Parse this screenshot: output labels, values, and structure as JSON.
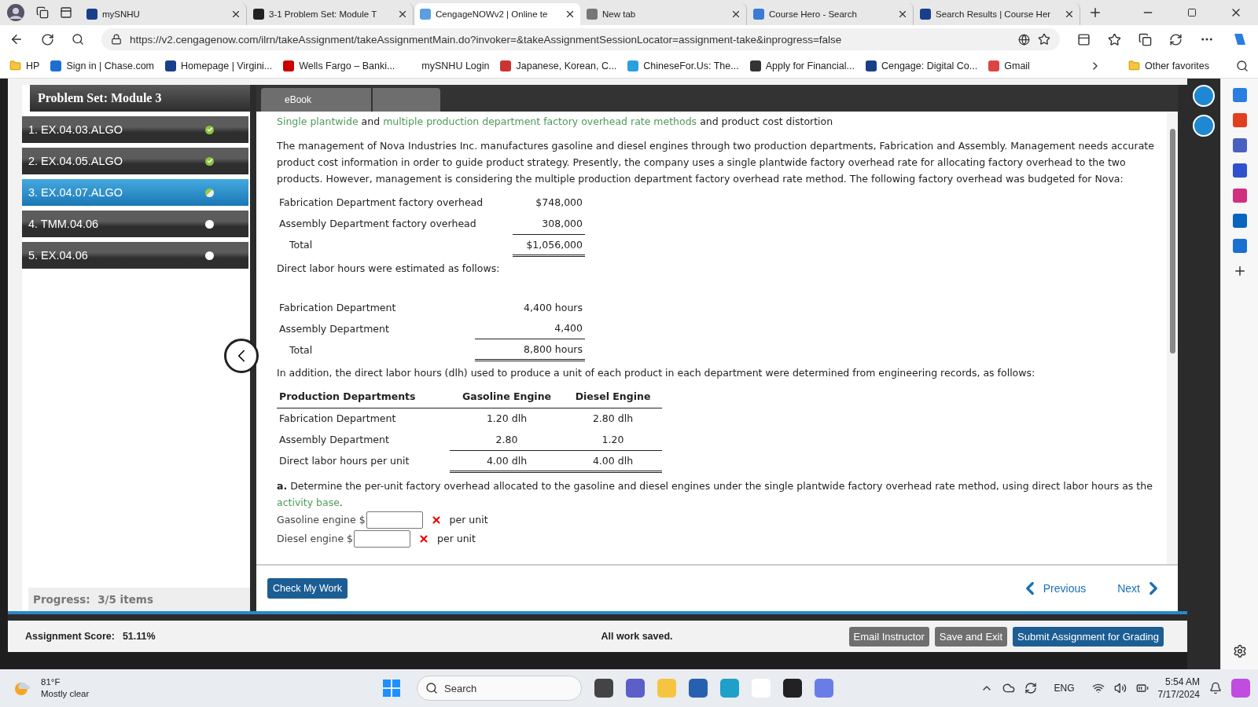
{
  "browser": {
    "tabs": [
      {
        "title": "mySNHU",
        "selected": false
      },
      {
        "title": "3-1 Problem Set: Module T",
        "selected": false
      },
      {
        "title": "CengageNOWv2 | Online te",
        "selected": true
      },
      {
        "title": "New tab",
        "selected": false
      },
      {
        "title": "Course Hero - Search",
        "selected": false
      },
      {
        "title": "Search Results | Course Her",
        "selected": false
      }
    ],
    "url": "https://v2.cengagenow.com/ilrn/takeAssignment/takeAssignmentMain.do?invoker=&takeAssignmentSessionLocator=assignment-take&inprogress=false",
    "bookmarks": [
      "HP",
      "Sign in | Chase.com",
      "Homepage | Virgini...",
      "Wells Fargo – Banki...",
      "mySNHU Login",
      "Japanese, Korean, C...",
      "ChineseFor.Us: The...",
      "Apply for Financial...",
      "Cengage: Digital Co...",
      "Gmail"
    ],
    "other_favorites": "Other favorites"
  },
  "assignment": {
    "title": "Problem Set: Module 3",
    "ebook_tab": "eBook",
    "items": [
      {
        "label": "1. EX.04.03.ALGO",
        "selected": false,
        "kind": "complete"
      },
      {
        "label": "2. EX.04.05.ALGO",
        "selected": false,
        "kind": "complete"
      },
      {
        "label": "3. EX.04.07.ALGO",
        "selected": true,
        "kind": "partial"
      },
      {
        "label": "4. TMM.04.06",
        "selected": false,
        "kind": "open"
      },
      {
        "label": "5. EX.04.06",
        "selected": false,
        "kind": "open"
      }
    ],
    "progress": "Progress:  3/5 items"
  },
  "content": {
    "heading": [
      {
        "kind": "link",
        "text": "Single plantwide"
      },
      {
        "kind": "text",
        "text": "and"
      },
      {
        "kind": "link",
        "text": "multiple production department factory overhead rate methods"
      },
      {
        "kind": "text",
        "text": "and product cost distortion"
      }
    ],
    "intro": "The management of Nova Industries Inc. manufactures gasoline and diesel engines through two production departments, Fabrication and Assembly. Management needs accurate product cost information in order to guide product strategy. Presently, the company uses a single plantwide factory overhead rate for allocating factory overhead to the two products. However, management is considering the multiple production department factory overhead rate method. The following factory overhead was budgeted for Nova:",
    "overhead": [
      {
        "label": "Fabrication Department factory overhead",
        "amount": "$748,000",
        "kind": "item"
      },
      {
        "label": "Assembly Department factory overhead",
        "amount": "308,000",
        "kind": "item"
      },
      {
        "label": "Total",
        "amount": "$1,056,000",
        "kind": "total"
      }
    ],
    "hours_intro": "Direct labor hours were estimated as follows:",
    "hours": [
      {
        "label": "Fabrication Department",
        "amount": "4,400 hours",
        "kind": "item"
      },
      {
        "label": "Assembly Department",
        "amount": "4,400",
        "kind": "item"
      },
      {
        "label": "Total",
        "amount": "8,800 hours",
        "kind": "total"
      }
    ],
    "dlh_intro": "In addition, the direct labor hours (dlh) used to produce a unit of each product in each department were determined from engineering records, as follows:",
    "production": {
      "columns": [
        "Production Departments",
        "Gasoline Engine",
        "Diesel Engine"
      ],
      "rows": [
        {
          "cells": [
            "Fabrication Department",
            "1.20 dlh",
            "2.80 dlh"
          ],
          "kind": "item"
        },
        {
          "cells": [
            "Assembly Department",
            "2.80",
            "1.20"
          ],
          "kind": "item"
        },
        {
          "cells": [
            "Direct labor hours per unit",
            "4.00 dlh",
            "4.00 dlh"
          ],
          "kind": "total"
        }
      ]
    },
    "question": {
      "letter": "a.",
      "text": "Determine the per-unit factory overhead allocated to the gasoline and diesel engines under the single plantwide factory overhead rate method, using direct labor hours as the",
      "link": "activity base",
      "end": "."
    },
    "answers": [
      {
        "label": "Gasoline engine $",
        "incorrect": true,
        "unit": "per unit"
      },
      {
        "label": "Diesel engine $",
        "incorrect": true,
        "unit": "per unit"
      }
    ]
  },
  "nav": {
    "check": "Check My Work",
    "previous": "Previous",
    "next": "Next"
  },
  "status_bar": {
    "score_label": "Assignment Score:",
    "score": "51.11%",
    "saved": "All work saved.",
    "buttons": [
      {
        "label": "Email Instructor",
        "kind": "secondary"
      },
      {
        "label": "Save and Exit",
        "kind": "secondary"
      },
      {
        "label": "Submit Assignment for Grading",
        "kind": "primary"
      }
    ]
  },
  "taskbar": {
    "temperature": "81°F",
    "weather": "Mostly clear",
    "search": "Search",
    "language": "ENG",
    "time": "5:54 AM",
    "date": "7/17/2024"
  }
}
